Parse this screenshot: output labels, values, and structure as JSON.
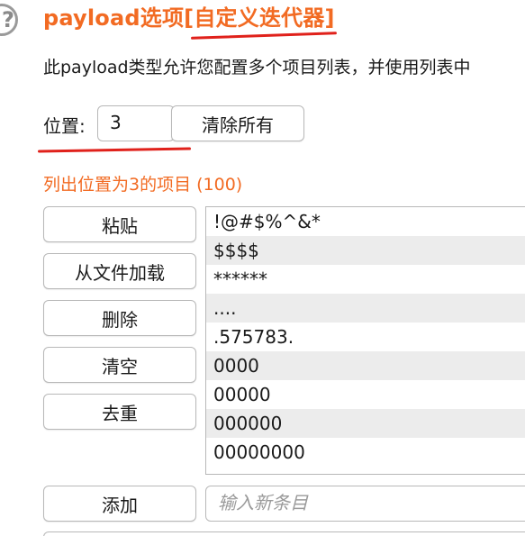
{
  "header": {
    "help_icon": "question-circle-icon",
    "title": "payload选项[自定义迭代器]",
    "description": "此payload类型允许您配置多个项目列表，并使用列表中"
  },
  "position": {
    "label": "位置:",
    "value": "3",
    "clear_all_label": "清除所有"
  },
  "list": {
    "heading": "列出位置为3的项目 (100)",
    "items": [
      "!@#$%^&*",
      "$$$$",
      "******",
      "....",
      ".575783.",
      "0000",
      "00000",
      "000000",
      "00000000"
    ]
  },
  "buttons": {
    "paste": "粘贴",
    "load_file": "从文件加载",
    "remove": "删除",
    "clear": "清空",
    "dedupe": "去重",
    "add": "添加"
  },
  "new_item": {
    "placeholder": "输入新条目"
  },
  "colors": {
    "accent": "#f26b23",
    "annotation_red": "#e0211b"
  }
}
